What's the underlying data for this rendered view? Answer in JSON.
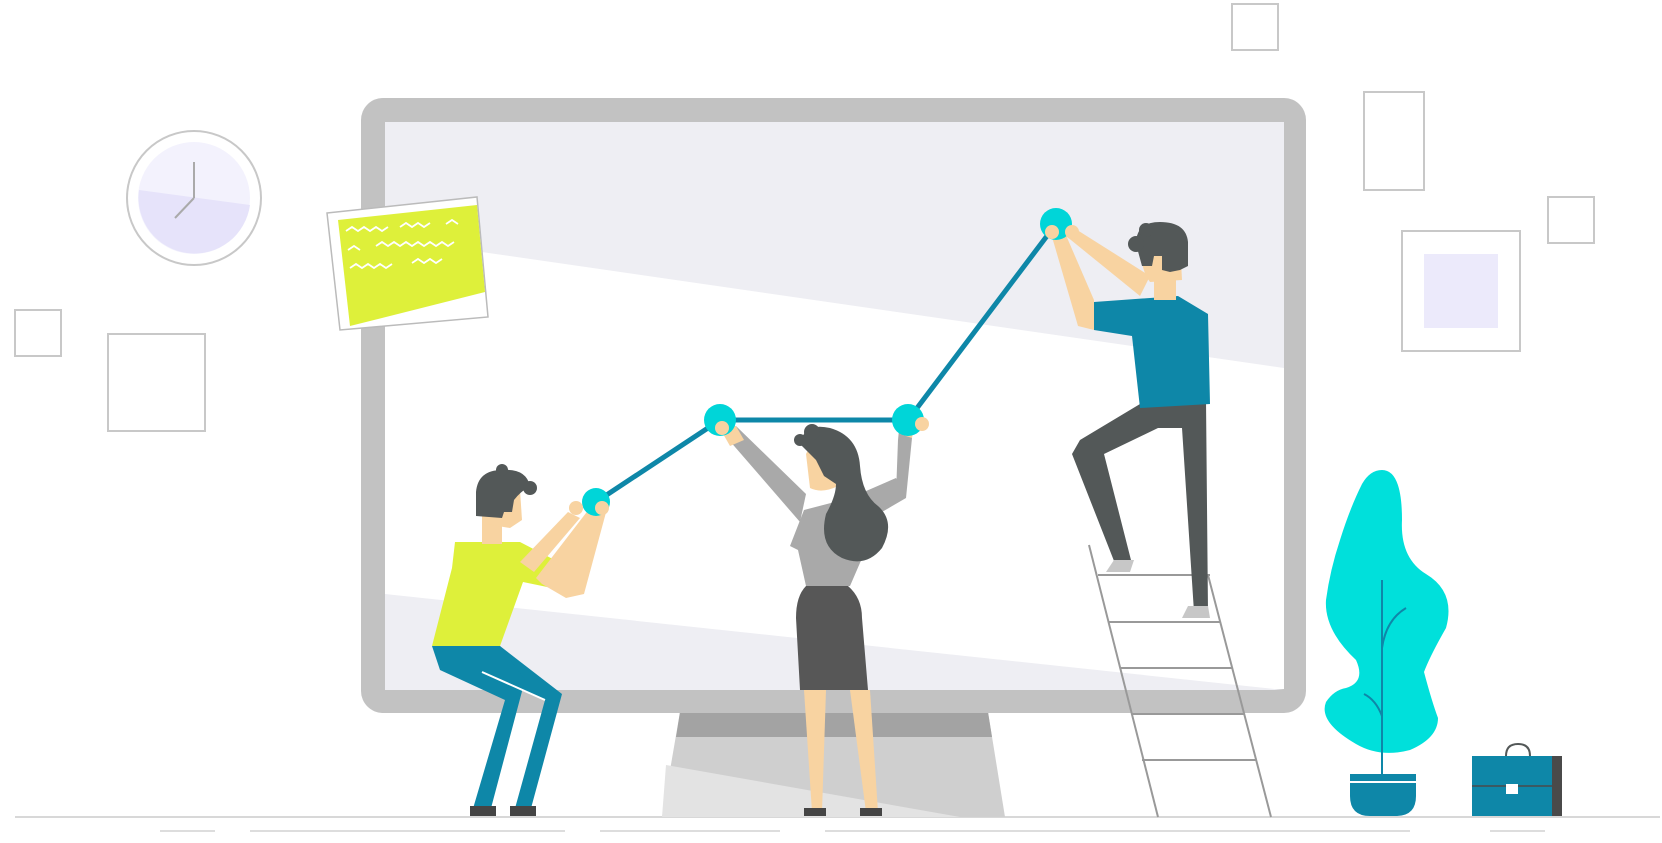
{
  "illustration": {
    "colors": {
      "monitor_frame": "#c2c2c2",
      "monitor_screen": "#eeeef3",
      "line": "#0e87a8",
      "node": "#00d5d8",
      "lime": "#def03a",
      "teal": "#0e87a8",
      "cyan_plant": "#00e0db",
      "hair": "#535858",
      "skin": "#f8d3a1",
      "skirt": "#575757",
      "lavender": "#eceafb"
    },
    "icons": [
      "wall-clock-icon",
      "sticky-note-icon",
      "plant-icon",
      "briefcase-icon",
      "ladder-icon"
    ],
    "chart_line_nodes": 4
  }
}
